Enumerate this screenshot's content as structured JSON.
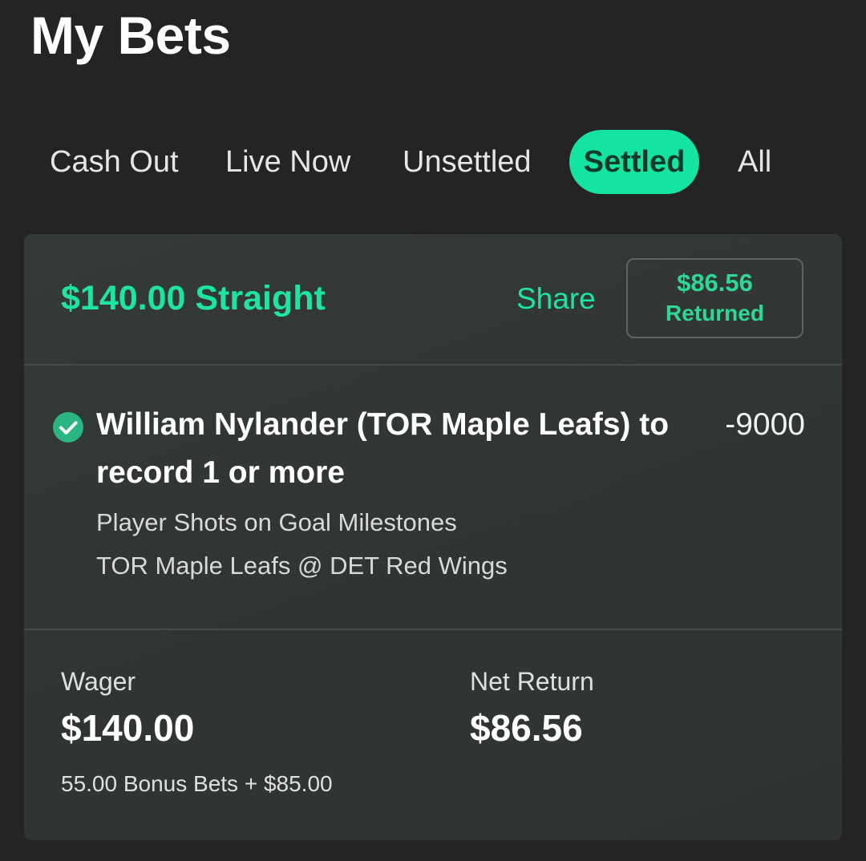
{
  "page": {
    "title": "My Bets"
  },
  "tabs": [
    {
      "label": "Cash Out",
      "active": false
    },
    {
      "label": "Live Now",
      "active": false
    },
    {
      "label": "Unsettled",
      "active": false
    },
    {
      "label": "Settled",
      "active": true
    },
    {
      "label": "All",
      "active": false
    }
  ],
  "bet": {
    "title": "$140.00 Straight",
    "share_label": "Share",
    "returned_amount": "$86.56",
    "returned_label": "Returned",
    "selection": {
      "status_icon": "check-circle-icon",
      "name": "William Nylander (TOR Maple Leafs) to record 1 or more",
      "odds": "-9000",
      "market": "Player Shots on Goal Milestones",
      "event": "TOR Maple Leafs @ DET Red Wings"
    },
    "wager_label": "Wager",
    "wager_value": "$140.00",
    "wager_breakdown": "55.00 Bonus Bets + $85.00",
    "net_return_label": "Net Return",
    "net_return_value": "$86.56"
  },
  "colors": {
    "background": "#242424",
    "card": "#323736",
    "accent": "#14e3a1",
    "accent_text": "#1ee3a1",
    "win_icon": "#2bb583"
  }
}
